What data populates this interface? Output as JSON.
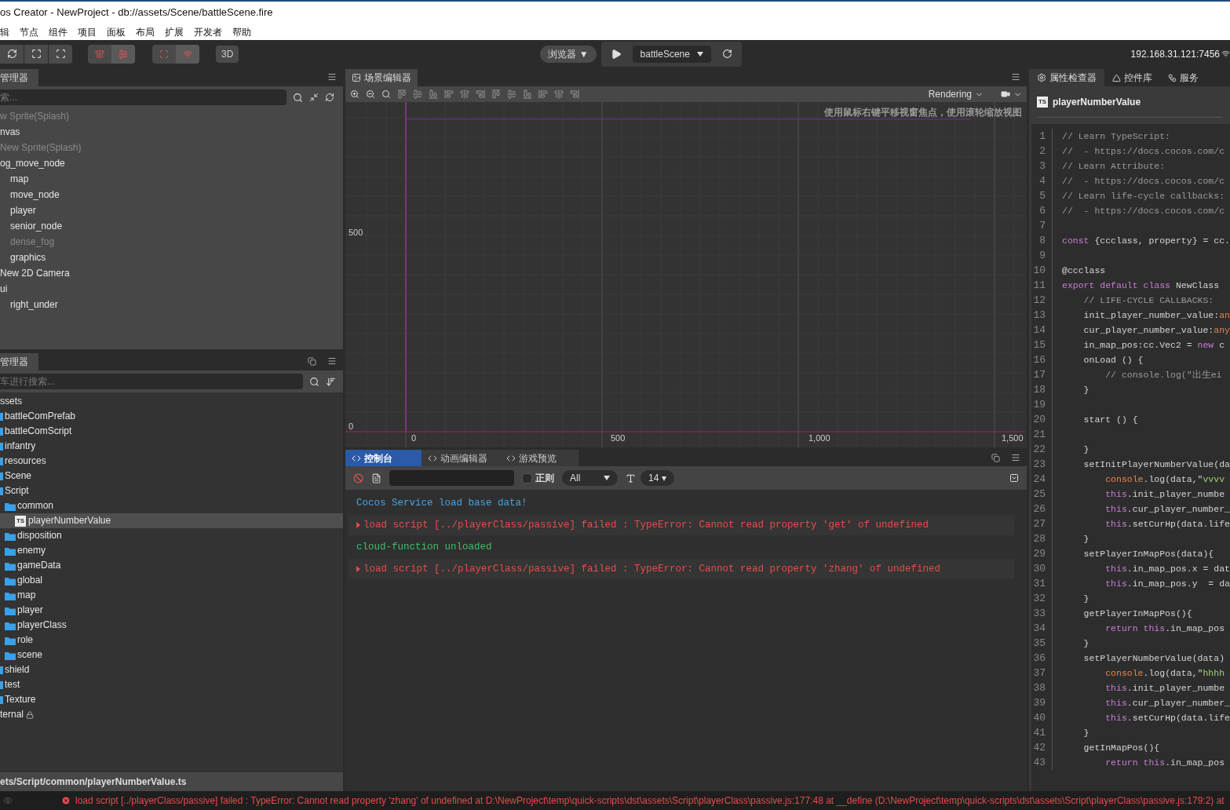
{
  "window": {
    "title": "os Creator - NewProject - db://assets/Scene/battleScene.fire"
  },
  "menu": [
    "辑",
    "节点",
    "组件",
    "项目",
    "面板",
    "布局",
    "扩展",
    "开发者",
    "帮助"
  ],
  "toolbar": {
    "mode_button": "3D",
    "preview_target": "浏览器 ▼",
    "scene_select": "battleScene",
    "address": "192.168.31.121:7456"
  },
  "hierarchy": {
    "tab": "管理器",
    "search_placeholder": "索...",
    "items": [
      {
        "label": "w Sprite(Splash)",
        "disabled": true
      },
      {
        "label": "nvas",
        "disabled": false
      },
      {
        "label": "New Sprite(Splash)",
        "disabled": true
      },
      {
        "label": "og_move_node",
        "disabled": false,
        "children": [
          {
            "label": "map",
            "disabled": false
          },
          {
            "label": "move_node",
            "disabled": false
          },
          {
            "label": "player",
            "disabled": false
          },
          {
            "label": "senior_node",
            "disabled": false
          },
          {
            "label": "dense_fog",
            "disabled": true
          },
          {
            "label": "graphics",
            "disabled": false
          }
        ]
      },
      {
        "label": "New 2D Camera",
        "disabled": false
      },
      {
        "label": "ui",
        "disabled": false,
        "children": [
          {
            "label": "right_under",
            "disabled": false
          }
        ]
      }
    ]
  },
  "assets": {
    "tab": "管理器",
    "search_placeholder": "车进行搜索...",
    "items": [
      {
        "label": "ssets",
        "kind": "root",
        "selected": false,
        "children": [
          {
            "label": "battleComPrefab",
            "kind": "folder",
            "selected": false
          },
          {
            "label": "battleComScript",
            "kind": "folder",
            "selected": false
          },
          {
            "label": "infantry",
            "kind": "folder",
            "selected": false
          },
          {
            "label": "resources",
            "kind": "folder",
            "selected": false
          },
          {
            "label": "Scene",
            "kind": "folder",
            "selected": false
          },
          {
            "label": "Script",
            "kind": "folder",
            "selected": false,
            "children": [
              {
                "label": "common",
                "kind": "folder",
                "selected": false,
                "children": [
                  {
                    "label": "playerNumberValue",
                    "kind": "script",
                    "icon_text": "TS",
                    "selected": true
                  }
                ]
              },
              {
                "label": "disposition",
                "kind": "folder",
                "selected": false
              },
              {
                "label": "enemy",
                "kind": "folder",
                "selected": false
              },
              {
                "label": "gameData",
                "kind": "folder",
                "selected": false
              },
              {
                "label": "global",
                "kind": "folder",
                "selected": false
              },
              {
                "label": "map",
                "kind": "folder",
                "selected": false
              },
              {
                "label": "player",
                "kind": "folder",
                "selected": false
              },
              {
                "label": "playerClass",
                "kind": "folder",
                "selected": false
              },
              {
                "label": "role",
                "kind": "folder",
                "selected": false
              },
              {
                "label": "scene",
                "kind": "folder",
                "selected": false
              }
            ]
          },
          {
            "label": "shield",
            "kind": "folder",
            "selected": false
          },
          {
            "label": "test",
            "kind": "folder",
            "selected": false
          },
          {
            "label": "Texture",
            "kind": "folder",
            "selected": false
          }
        ]
      },
      {
        "label": "ternal",
        "kind": "locked",
        "selected": false
      }
    ],
    "path": "ets/Script/common/playerNumberValue.ts"
  },
  "scene": {
    "tab": "场景编辑器",
    "render_menu": "Rendering",
    "hint": "使用鼠标右键平移视窗焦点，使用滚轮缩放视图",
    "y_labels": [
      "500",
      "0"
    ],
    "x_labels": [
      "0",
      "500",
      "1,000",
      "1,500"
    ]
  },
  "console": {
    "tabs": [
      {
        "label": "控制台",
        "selected": true
      },
      {
        "label": "动画编辑器",
        "selected": false
      },
      {
        "label": "游戏预览",
        "selected": false
      }
    ],
    "regex": {
      "label": "正则",
      "checked": false
    },
    "level_select": "All",
    "font_size": "14 ▾",
    "logs": [
      {
        "kind": "info",
        "text": "Cocos Service load base data!"
      },
      {
        "kind": "error",
        "text": "load script [../playerClass/passive] failed : TypeError: Cannot read property 'get' of undefined"
      },
      {
        "kind": "success",
        "text": "cloud-function unloaded"
      },
      {
        "kind": "error",
        "text": "load script [../playerClass/passive] failed : TypeError: Cannot read property 'zhang' of undefined"
      }
    ]
  },
  "inspector": {
    "tabs": [
      {
        "label": "属性检查器",
        "selected": true
      },
      {
        "label": "控件库",
        "selected": false
      },
      {
        "label": "服务",
        "selected": false
      }
    ],
    "file": "playerNumberValue",
    "file_icon": "TS",
    "code": [
      {
        "n": "1",
        "parts": [
          {
            "kind": "comment",
            "text": "// Learn TypeScript:"
          }
        ]
      },
      {
        "n": "2",
        "parts": [
          {
            "kind": "comment",
            "text": "//  - https://docs.cocos.com/c"
          }
        ]
      },
      {
        "n": "3",
        "parts": [
          {
            "kind": "comment",
            "text": "// Learn Attribute:"
          }
        ]
      },
      {
        "n": "4",
        "parts": [
          {
            "kind": "comment",
            "text": "//  - https://docs.cocos.com/c"
          }
        ]
      },
      {
        "n": "5",
        "parts": [
          {
            "kind": "comment",
            "text": "// Learn life-cycle callbacks:"
          }
        ]
      },
      {
        "n": "6",
        "parts": [
          {
            "kind": "comment",
            "text": "//  - https://docs.cocos.com/c"
          }
        ]
      },
      {
        "n": "7"
      },
      {
        "n": "8",
        "parts": [
          {
            "kind": "keyword",
            "text": "const"
          },
          {
            "kind": "plain",
            "text": " {ccclass, property} = cc."
          }
        ]
      },
      {
        "n": "9"
      },
      {
        "n": "10",
        "parts": [
          {
            "kind": "plain",
            "text": "@ccclass"
          }
        ]
      },
      {
        "n": "11",
        "parts": [
          {
            "kind": "keyword",
            "text": "export default class"
          },
          {
            "kind": "plain",
            "text": " NewClass"
          }
        ]
      },
      {
        "n": "12",
        "parts": [
          {
            "kind": "comment",
            "text": "    // LIFE-CYCLE CALLBACKS:"
          }
        ]
      },
      {
        "n": "13",
        "parts": [
          {
            "kind": "plain",
            "text": "    init_player_number_value:"
          },
          {
            "kind": "type",
            "text": "an"
          }
        ]
      },
      {
        "n": "14",
        "parts": [
          {
            "kind": "plain",
            "text": "    cur_player_number_value:"
          },
          {
            "kind": "type",
            "text": "any"
          }
        ]
      },
      {
        "n": "15",
        "parts": [
          {
            "kind": "plain",
            "text": "    in_map_pos:cc.Vec2 = "
          },
          {
            "kind": "keyword",
            "text": "new"
          },
          {
            "kind": "plain",
            "text": " c"
          }
        ]
      },
      {
        "n": "16",
        "parts": [
          {
            "kind": "plain",
            "text": "    onLoad () {"
          }
        ]
      },
      {
        "n": "17",
        "parts": [
          {
            "kind": "comment",
            "text": "        // console.log(\"出生ei"
          }
        ]
      },
      {
        "n": "18",
        "parts": [
          {
            "kind": "plain",
            "text": "    }"
          }
        ]
      },
      {
        "n": "19"
      },
      {
        "n": "20",
        "parts": [
          {
            "kind": "plain",
            "text": "    start () {"
          }
        ]
      },
      {
        "n": "21"
      },
      {
        "n": "22",
        "parts": [
          {
            "kind": "plain",
            "text": "    }"
          }
        ]
      },
      {
        "n": "23",
        "parts": [
          {
            "kind": "plain",
            "text": "    setInitPlayerNumberValue(da"
          }
        ]
      },
      {
        "n": "24",
        "parts": [
          {
            "kind": "builtin",
            "text": "        console"
          },
          {
            "kind": "plain",
            "text": ".log(data,\""
          },
          {
            "kind": "string",
            "text": "vvvv"
          }
        ]
      },
      {
        "n": "25",
        "parts": [
          {
            "kind": "keyword",
            "text": "        this"
          },
          {
            "kind": "plain",
            "text": ".init_player_numbe"
          }
        ]
      },
      {
        "n": "26",
        "parts": [
          {
            "kind": "keyword",
            "text": "        this"
          },
          {
            "kind": "plain",
            "text": ".cur_player_number_"
          }
        ]
      },
      {
        "n": "27",
        "parts": [
          {
            "kind": "keyword",
            "text": "        this"
          },
          {
            "kind": "plain",
            "text": ".setCurHp(data.life"
          }
        ]
      },
      {
        "n": "28",
        "parts": [
          {
            "kind": "plain",
            "text": "    }"
          }
        ]
      },
      {
        "n": "29",
        "parts": [
          {
            "kind": "plain",
            "text": "    setPlayerInMapPos(data){"
          }
        ]
      },
      {
        "n": "30",
        "parts": [
          {
            "kind": "keyword",
            "text": "        this"
          },
          {
            "kind": "plain",
            "text": ".in_map_pos.x = dat"
          }
        ]
      },
      {
        "n": "31",
        "parts": [
          {
            "kind": "keyword",
            "text": "        this"
          },
          {
            "kind": "plain",
            "text": ".in_map_pos.y  = da"
          }
        ]
      },
      {
        "n": "32",
        "parts": [
          {
            "kind": "plain",
            "text": "    }"
          }
        ]
      },
      {
        "n": "33",
        "parts": [
          {
            "kind": "plain",
            "text": "    getPlayerInMapPos(){"
          }
        ]
      },
      {
        "n": "34",
        "parts": [
          {
            "kind": "keyword",
            "text": "        return this"
          },
          {
            "kind": "plain",
            "text": ".in_map_pos"
          }
        ]
      },
      {
        "n": "35",
        "parts": [
          {
            "kind": "plain",
            "text": "    }"
          }
        ]
      },
      {
        "n": "36",
        "parts": [
          {
            "kind": "plain",
            "text": "    setPlayerNumberValue(data)"
          }
        ]
      },
      {
        "n": "37",
        "parts": [
          {
            "kind": "builtin",
            "text": "        console"
          },
          {
            "kind": "plain",
            "text": ".log(data,\""
          },
          {
            "kind": "string",
            "text": "hhhh"
          }
        ]
      },
      {
        "n": "38",
        "parts": [
          {
            "kind": "keyword",
            "text": "        this"
          },
          {
            "kind": "plain",
            "text": ".init_player_numbe"
          }
        ]
      },
      {
        "n": "39",
        "parts": [
          {
            "kind": "keyword",
            "text": "        this"
          },
          {
            "kind": "plain",
            "text": ".cur_player_number_"
          }
        ]
      },
      {
        "n": "40",
        "parts": [
          {
            "kind": "keyword",
            "text": "        this"
          },
          {
            "kind": "plain",
            "text": ".setCurHp(data.life"
          }
        ]
      },
      {
        "n": "41",
        "parts": [
          {
            "kind": "plain",
            "text": "    }"
          }
        ]
      },
      {
        "n": "42",
        "parts": [
          {
            "kind": "plain",
            "text": "    getInMapPos(){"
          }
        ]
      },
      {
        "n": "43",
        "parts": [
          {
            "kind": "keyword",
            "text": "        return this"
          },
          {
            "kind": "plain",
            "text": ".in_map_pos"
          }
        ]
      }
    ]
  },
  "status_bar": {
    "message": "load script [../playerClass/passive] failed : TypeError: Cannot read property 'zhang' of undefined at D:\\NewProject\\temp\\quick-scripts\\dst\\assets\\Script\\playerClass\\passive.js:177:48 at __define (D:\\NewProject\\temp\\quick-scripts\\dst\\assets\\Script\\playerClass\\passive.js:179:2) at"
  }
}
